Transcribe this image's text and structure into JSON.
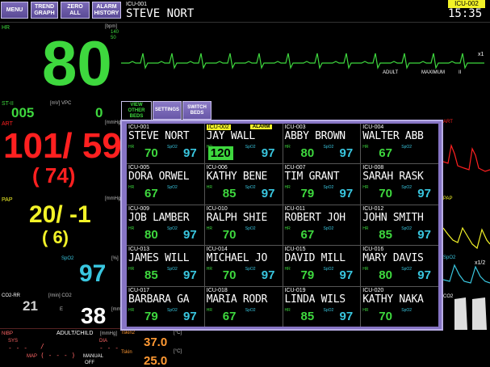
{
  "toolbar": {
    "menu": "MENU",
    "trend_graph": "TREND\nGRAPH",
    "zero_all": "ZERO ALL",
    "alarm_history": "ALARM\nHISTORY"
  },
  "patient": {
    "bed_id": "ICU-001",
    "name": "STEVE NORT",
    "monitor_bed_badge": "ICU-002",
    "time": "15:35"
  },
  "hr": {
    "label": "HR",
    "unit": "[bpm]",
    "limit_high": "140",
    "limit_low": "50",
    "value": "80",
    "ecg_footer_left": "ADULT",
    "ecg_footer_mid": "MAXIMUM",
    "ecg_footer_right": "II",
    "gain": "x1"
  },
  "st": {
    "label": "ST-II",
    "unit": "[mV] VPC",
    "value": "005",
    "vpc": "0"
  },
  "art": {
    "label": "ART",
    "unit": "[mmHg]",
    "sys_dia": "101/ 59",
    "mean": "( 74)"
  },
  "pap": {
    "label": "PAP",
    "unit": "[mmHg]",
    "sys_dia": "20/ -1",
    "mean": "( 6)"
  },
  "spo2": {
    "label": "SpO2",
    "unit": "[%]",
    "value": "97"
  },
  "co2": {
    "label": "CO2-RR",
    "unit": "[/min] CO2",
    "rr": "21",
    "value": "38",
    "unit2": "[mmHg]",
    "sub": "E"
  },
  "nibp": {
    "label": "NIBP",
    "mode": "ADULT/CHILD",
    "sys_label": "SYS",
    "dia_label": "DIA",
    "map_label": "MAP",
    "manual_label": "MANUAL",
    "off_label": "OFF",
    "unit": "[mmHg]"
  },
  "temp": {
    "label1": "Tskin2",
    "label2": "Tskin",
    "unit": "[°C]",
    "value1": "37.0",
    "value2": "25.0"
  },
  "tabs": {
    "view_other_beds": "VIEW\nOTHER BEDS",
    "settings": "SETTINGS",
    "switch_beds": "SWITCH\nBEDS"
  },
  "right_labels": {
    "art": "ART",
    "pap": "PAP",
    "spo2": "SpO2",
    "co2": "CO2",
    "pap_scale": "x1/2"
  },
  "beds": [
    {
      "id": "ICU-001",
      "name": "STEVE NORT",
      "hr": "70",
      "spo2": "97"
    },
    {
      "id": "ICU-002",
      "name": "JAY WALL",
      "hr": "120",
      "spo2": "97",
      "alarm": "ALARM"
    },
    {
      "id": "ICU-003",
      "name": "ABBY BROWN",
      "hr": "80",
      "spo2": "97"
    },
    {
      "id": "ICU-004",
      "name": "WALTER ABB",
      "hr": "67",
      "spo2": ""
    },
    {
      "id": "ICU-005",
      "name": "DORA ORWEL",
      "hr": "67",
      "spo2": ""
    },
    {
      "id": "ICU-006",
      "name": "KATHY BENE",
      "hr": "85",
      "spo2": "97"
    },
    {
      "id": "ICU-007",
      "name": "TIM GRANT",
      "hr": "79",
      "spo2": "97"
    },
    {
      "id": "ICU-008",
      "name": "SARAH RASK",
      "hr": "70",
      "spo2": "97"
    },
    {
      "id": "ICU-009",
      "name": "JOB LAMBER",
      "hr": "80",
      "spo2": "97"
    },
    {
      "id": "ICU-010",
      "name": "RALPH SHIE",
      "hr": "70",
      "spo2": ""
    },
    {
      "id": "ICU-011",
      "name": "ROBERT JOH",
      "hr": "67",
      "spo2": ""
    },
    {
      "id": "ICU-012",
      "name": "JOHN SMITH",
      "hr": "85",
      "spo2": "97"
    },
    {
      "id": "ICU-013",
      "name": "JAMES WILL",
      "hr": "85",
      "spo2": "97"
    },
    {
      "id": "ICU-014",
      "name": "MICHAEL JO",
      "hr": "70",
      "spo2": "97"
    },
    {
      "id": "ICU-015",
      "name": "DAVID MILL",
      "hr": "79",
      "spo2": "97"
    },
    {
      "id": "ICU-016",
      "name": "MARY DAVIS",
      "hr": "80",
      "spo2": "97"
    },
    {
      "id": "ICU-017",
      "name": "BARBARA GA",
      "hr": "79",
      "spo2": "97"
    },
    {
      "id": "ICU-018",
      "name": "MARIA RODR",
      "hr": "67",
      "spo2": ""
    },
    {
      "id": "ICU-019",
      "name": "LINDA WILS",
      "hr": "85",
      "spo2": "97"
    },
    {
      "id": "ICU-020",
      "name": "KATHY NAKA",
      "hr": "70",
      "spo2": ""
    }
  ],
  "bed_labels": {
    "hr": "HR",
    "spo2": "SpO2"
  }
}
